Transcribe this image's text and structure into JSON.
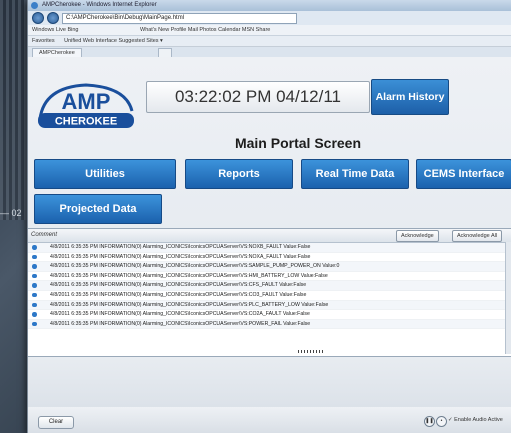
{
  "side_label": "— 02",
  "browser": {
    "window_title": "AMPCherokee - Windows Internet Explorer",
    "address": "C:\\AMPCherokee\\Bin\\Debug\\MainPage.html",
    "search_placeholder": "Windows Live Bing",
    "menu": "What's New   Profile   Mail   Photos   Calendar   MSN   Share",
    "favorites": "Favorites",
    "fav_items": "Unified Web Interface    Suggested Sites ▾",
    "tab_label": "AMPCherokee"
  },
  "logo": {
    "line1": "AMP",
    "line2": "CHEROKEE"
  },
  "clock": "03:22:02 PM 04/12/11",
  "alarm_history_label": "Alarm History",
  "portal_title": "Main Portal Screen",
  "nav": {
    "utilities": "Utilities",
    "reports": "Reports",
    "real_time_data": "Real Time Data",
    "cems_interface": "CEMS Interface",
    "projected_data": "Projected Data"
  },
  "alarms": {
    "column_header": "Comment",
    "acknowledge": "Acknowledge",
    "acknowledge_all": "Acknowledge All",
    "rows": [
      "4/8/2011 6:35:35 PM INFORMATION(0) Alarming_ICONICS\\IconicsOPCUAServer\\VS:NOXB_FAULT Value:False",
      "4/8/2011 6:35:35 PM INFORMATION(0) Alarming_ICONICS\\IconicsOPCUAServer\\VS:NOXA_FAULT Value:False",
      "4/8/2011 6:35:35 PM INFORMATION(0) Alarming_ICONICS\\IconicsOPCUAServer\\VS:SAMPLE_PUMP_POWER_ON Value:0",
      "4/8/2011 6:35:35 PM INFORMATION(0) Alarming_ICONICS\\IconicsOPCUAServer\\VS:HMI_BATTERY_LOW Value:False",
      "4/8/2011 6:35:35 PM INFORMATION(0) Alarming_ICONICS\\IconicsOPCUAServer\\VS:CFS_FAULT Value:False",
      "4/8/2011 6:35:35 PM INFORMATION(0) Alarming_ICONICS\\IconicsOPCUAServer\\VS:CO3_FAULT Value:False",
      "4/8/2011 6:35:35 PM INFORMATION(0) Alarming_ICONICS\\IconicsOPCUAServer\\VS:PLC_BATTERY_LOW Value:False",
      "4/8/2011 6:35:35 PM INFORMATION(0) Alarming_ICONICS\\IconicsOPCUAServer\\VS:CO2A_FAULT Value:False",
      "4/8/2011 6:35:35 PM INFORMATION(0) Alarming_ICONICS\\IconicsOPCUAServer\\VS:POWER_FAIL Value:False"
    ]
  },
  "footer": {
    "clear": "Clear",
    "enable_audio": "✓ Enable Audio  Active"
  },
  "colors": {
    "button_blue": "#1d5fa8",
    "logo_blue": "#1a4f9c"
  }
}
